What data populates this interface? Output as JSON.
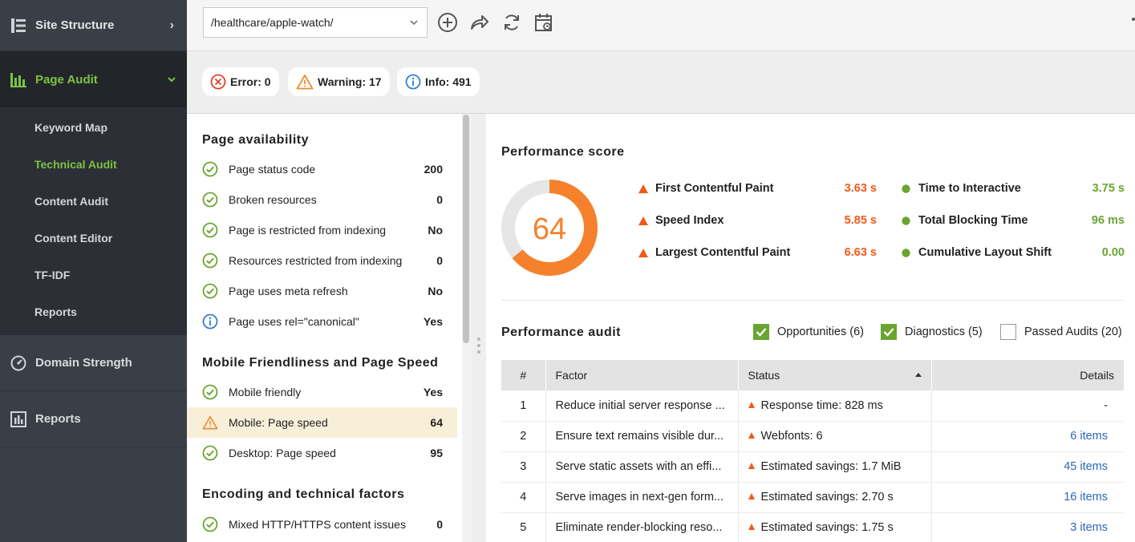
{
  "sidebar": {
    "site_structure": "Site Structure",
    "page_audit": "Page Audit",
    "sub_items": [
      "Keyword Map",
      "Technical Audit",
      "Content Audit",
      "Content Editor",
      "TF-IDF",
      "Reports"
    ],
    "domain_strength": "Domain Strength",
    "reports": "Reports"
  },
  "toolbar": {
    "url_value": "/healthcare/apple-watch/"
  },
  "filters": {
    "error": "Error: 0",
    "warning": "Warning: 17",
    "info": "Info: 491"
  },
  "left": {
    "availability_title": "Page availability",
    "availability": [
      {
        "label": "Page status code",
        "value": "200",
        "icon": "check-icon"
      },
      {
        "label": "Broken resources",
        "value": "0",
        "icon": "check-icon"
      },
      {
        "label": "Page is restricted from indexing",
        "value": "No",
        "icon": "check-icon"
      },
      {
        "label": "Resources restricted from indexing",
        "value": "0",
        "icon": "check-icon"
      },
      {
        "label": "Page uses meta refresh",
        "value": "No",
        "icon": "check-icon"
      },
      {
        "label": "Page uses rel=\"canonical\"",
        "value": "Yes",
        "icon": "info-icon"
      }
    ],
    "mobile_title": "Mobile Friendliness and Page Speed",
    "mobile": [
      {
        "label": "Mobile friendly",
        "value": "Yes",
        "icon": "check-icon"
      },
      {
        "label": "Mobile: Page speed",
        "value": "64",
        "icon": "warning-icon"
      },
      {
        "label": "Desktop: Page speed",
        "value": "95",
        "icon": "check-icon"
      }
    ],
    "encoding_title": "Encoding and technical factors",
    "encoding": [
      {
        "label": "Mixed HTTP/HTTPS content issues",
        "value": "0",
        "icon": "check-icon"
      }
    ]
  },
  "performance": {
    "score_title": "Performance score",
    "score": "64",
    "score_fraction": 0.64,
    "metrics_left": [
      {
        "name": "First Contentful Paint",
        "value": "3.63 s"
      },
      {
        "name": "Speed Index",
        "value": "5.85 s"
      },
      {
        "name": "Largest Contentful Paint",
        "value": "6.63 s"
      }
    ],
    "metrics_right": [
      {
        "name": "Time to Interactive",
        "value": "3.75 s"
      },
      {
        "name": "Total Blocking Time",
        "value": "96 ms"
      },
      {
        "name": "Cumulative Layout Shift",
        "value": "0.00"
      }
    ],
    "colors": {
      "bad": "#f05a1a",
      "good": "#6aa531",
      "ring": "#f5812c",
      "ring_bg": "#e6e6e6"
    }
  },
  "audit": {
    "title": "Performance audit",
    "opportunities": "Opportunities (6)",
    "diagnostics": "Diagnostics (5)",
    "passed": "Passed Audits (20)",
    "headers": {
      "num": "#",
      "factor": "Factor",
      "status": "Status",
      "details": "Details"
    },
    "rows": [
      {
        "num": "1",
        "factor": "Reduce initial server response ...",
        "status": "Response time: 828 ms",
        "details": "-"
      },
      {
        "num": "2",
        "factor": "Ensure text remains visible dur...",
        "status": "Webfonts: 6",
        "details": "6 items"
      },
      {
        "num": "3",
        "factor": "Serve static assets with an effi...",
        "status": "Estimated savings: 1.7 MiB",
        "details": "45 items"
      },
      {
        "num": "4",
        "factor": "Serve images in next-gen form...",
        "status": "Estimated savings: 2.70 s",
        "details": "16 items"
      },
      {
        "num": "5",
        "factor": "Eliminate render-blocking reso...",
        "status": "Estimated savings: 1.75 s",
        "details": "3 items"
      }
    ]
  }
}
